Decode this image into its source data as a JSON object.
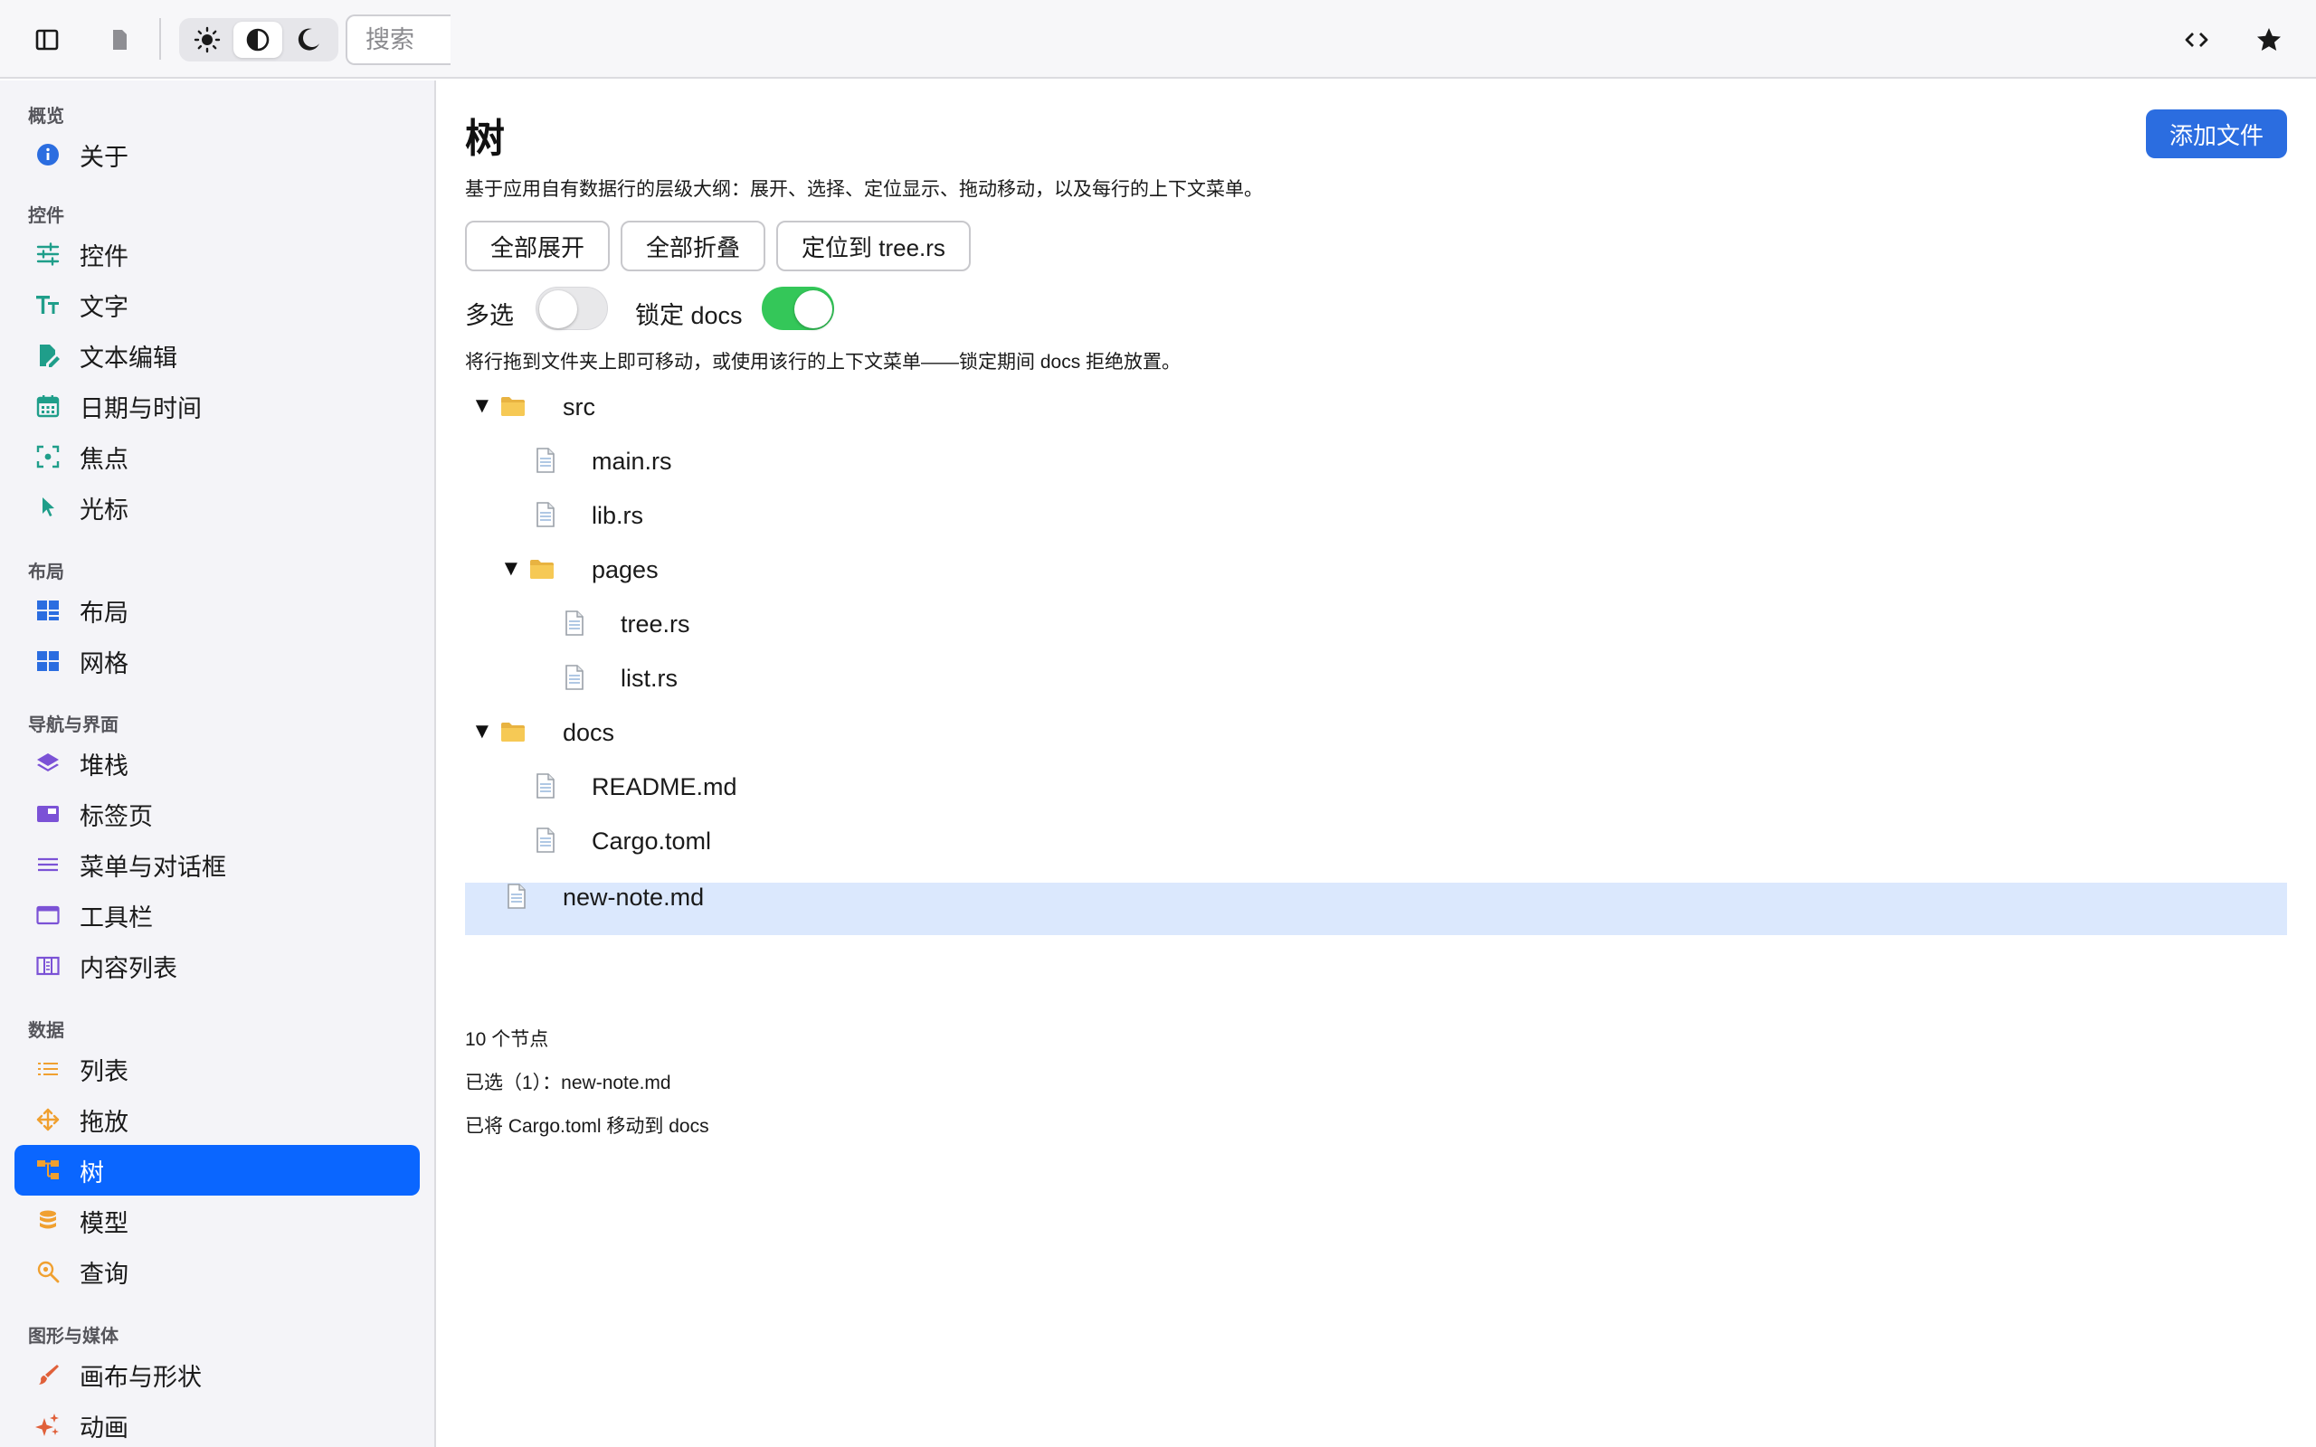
{
  "toolbar": {
    "search_placeholder": "搜索",
    "colors": {
      "accent": "#0a66ff",
      "button": "#2b6de0",
      "switch_on": "#34c759"
    }
  },
  "sidebar": {
    "sections": [
      {
        "title": "概览",
        "items": [
          {
            "label": "关于",
            "icon": "info-icon",
            "color": "#2b6de0"
          }
        ]
      },
      {
        "title": "控件",
        "items": [
          {
            "label": "控件",
            "icon": "sliders-icon",
            "color": "#1f9e8a"
          },
          {
            "label": "文字",
            "icon": "text-size-icon",
            "color": "#1f9e8a"
          },
          {
            "label": "文本编辑",
            "icon": "document-edit-icon",
            "color": "#1f9e8a"
          },
          {
            "label": "日期与时间",
            "icon": "calendar-icon",
            "color": "#1f9e8a"
          },
          {
            "label": "焦点",
            "icon": "focus-icon",
            "color": "#1f9e8a"
          },
          {
            "label": "光标",
            "icon": "cursor-icon",
            "color": "#1f9e8a"
          }
        ]
      },
      {
        "title": "布局",
        "items": [
          {
            "label": "布局",
            "icon": "layout-icon",
            "color": "#2b6de0"
          },
          {
            "label": "网格",
            "icon": "grid-icon",
            "color": "#2b6de0"
          }
        ]
      },
      {
        "title": "导航与界面",
        "items": [
          {
            "label": "堆栈",
            "icon": "stack-icon",
            "color": "#7b52d6"
          },
          {
            "label": "标签页",
            "icon": "tabs-icon",
            "color": "#7b52d6"
          },
          {
            "label": "菜单与对话框",
            "icon": "menu-icon",
            "color": "#7b52d6"
          },
          {
            "label": "工具栏",
            "icon": "window-icon",
            "color": "#7b52d6"
          },
          {
            "label": "内容列表",
            "icon": "columns-icon",
            "color": "#7b52d6"
          }
        ]
      },
      {
        "title": "数据",
        "items": [
          {
            "label": "列表",
            "icon": "list-icon",
            "color": "#f0a030"
          },
          {
            "label": "拖放",
            "icon": "move-icon",
            "color": "#f0a030"
          },
          {
            "label": "树",
            "icon": "tree-icon",
            "color": "#f0a030"
          },
          {
            "label": "模型",
            "icon": "database-icon",
            "color": "#f0a030"
          },
          {
            "label": "查询",
            "icon": "search-zoom-icon",
            "color": "#f0a030"
          }
        ]
      },
      {
        "title": "图形与媒体",
        "items": [
          {
            "label": "画布与形状",
            "icon": "brush-icon",
            "color": "#e0603a"
          },
          {
            "label": "动画",
            "icon": "sparkles-icon",
            "color": "#e0603a"
          }
        ]
      }
    ],
    "active_item": "树"
  },
  "main": {
    "title": "树",
    "add_button": "添加文件",
    "description": "基于应用自有数据行的层级大纲：展开、选择、定位显示、拖动移动，以及每行的上下文菜单。",
    "buttons": [
      "全部展开",
      "全部折叠",
      "定位到 tree.rs"
    ],
    "toggles": [
      {
        "label": "多选",
        "on": false
      },
      {
        "label": "锁定 docs",
        "on": true
      }
    ],
    "hint": "将行拖到文件夹上即可移动，或使用该行的上下文菜单——锁定期间 docs 拒绝放置。",
    "tree": [
      {
        "label": "src",
        "type": "folder",
        "depth": 0,
        "expanded": true
      },
      {
        "label": "main.rs",
        "type": "file",
        "depth": 1
      },
      {
        "label": "lib.rs",
        "type": "file",
        "depth": 1
      },
      {
        "label": "pages",
        "type": "folder",
        "depth": 1,
        "expanded": true
      },
      {
        "label": "tree.rs",
        "type": "file",
        "depth": 2
      },
      {
        "label": "list.rs",
        "type": "file",
        "depth": 2
      },
      {
        "label": "docs",
        "type": "folder",
        "depth": 0,
        "expanded": true
      },
      {
        "label": "README.md",
        "type": "file",
        "depth": 1
      },
      {
        "label": "Cargo.toml",
        "type": "file",
        "depth": 1
      },
      {
        "label": "new-note.md",
        "type": "file",
        "depth": 0,
        "selected": true
      }
    ],
    "expand_arrow": "▼",
    "stats": {
      "node_count": "10 个节点",
      "selection": "已选（1）：new-note.md",
      "last_action": "已将 Cargo.toml 移动到 docs"
    }
  }
}
